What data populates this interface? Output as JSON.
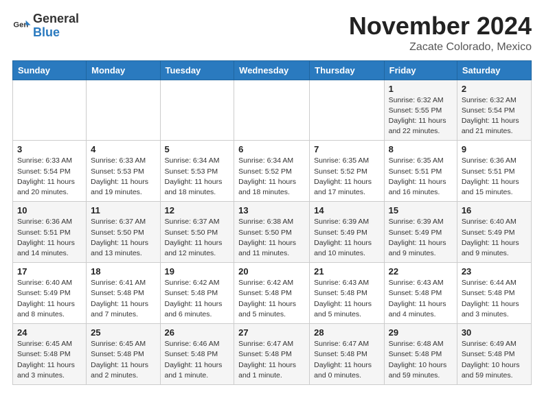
{
  "logo": {
    "general": "General",
    "blue": "Blue"
  },
  "title": "November 2024",
  "location": "Zacate Colorado, Mexico",
  "weekdays": [
    "Sunday",
    "Monday",
    "Tuesday",
    "Wednesday",
    "Thursday",
    "Friday",
    "Saturday"
  ],
  "weeks": [
    [
      {
        "day": "",
        "info": ""
      },
      {
        "day": "",
        "info": ""
      },
      {
        "day": "",
        "info": ""
      },
      {
        "day": "",
        "info": ""
      },
      {
        "day": "",
        "info": ""
      },
      {
        "day": "1",
        "info": "Sunrise: 6:32 AM\nSunset: 5:55 PM\nDaylight: 11 hours\nand 22 minutes."
      },
      {
        "day": "2",
        "info": "Sunrise: 6:32 AM\nSunset: 5:54 PM\nDaylight: 11 hours\nand 21 minutes."
      }
    ],
    [
      {
        "day": "3",
        "info": "Sunrise: 6:33 AM\nSunset: 5:54 PM\nDaylight: 11 hours\nand 20 minutes."
      },
      {
        "day": "4",
        "info": "Sunrise: 6:33 AM\nSunset: 5:53 PM\nDaylight: 11 hours\nand 19 minutes."
      },
      {
        "day": "5",
        "info": "Sunrise: 6:34 AM\nSunset: 5:53 PM\nDaylight: 11 hours\nand 18 minutes."
      },
      {
        "day": "6",
        "info": "Sunrise: 6:34 AM\nSunset: 5:52 PM\nDaylight: 11 hours\nand 18 minutes."
      },
      {
        "day": "7",
        "info": "Sunrise: 6:35 AM\nSunset: 5:52 PM\nDaylight: 11 hours\nand 17 minutes."
      },
      {
        "day": "8",
        "info": "Sunrise: 6:35 AM\nSunset: 5:51 PM\nDaylight: 11 hours\nand 16 minutes."
      },
      {
        "day": "9",
        "info": "Sunrise: 6:36 AM\nSunset: 5:51 PM\nDaylight: 11 hours\nand 15 minutes."
      }
    ],
    [
      {
        "day": "10",
        "info": "Sunrise: 6:36 AM\nSunset: 5:51 PM\nDaylight: 11 hours\nand 14 minutes."
      },
      {
        "day": "11",
        "info": "Sunrise: 6:37 AM\nSunset: 5:50 PM\nDaylight: 11 hours\nand 13 minutes."
      },
      {
        "day": "12",
        "info": "Sunrise: 6:37 AM\nSunset: 5:50 PM\nDaylight: 11 hours\nand 12 minutes."
      },
      {
        "day": "13",
        "info": "Sunrise: 6:38 AM\nSunset: 5:50 PM\nDaylight: 11 hours\nand 11 minutes."
      },
      {
        "day": "14",
        "info": "Sunrise: 6:39 AM\nSunset: 5:49 PM\nDaylight: 11 hours\nand 10 minutes."
      },
      {
        "day": "15",
        "info": "Sunrise: 6:39 AM\nSunset: 5:49 PM\nDaylight: 11 hours\nand 9 minutes."
      },
      {
        "day": "16",
        "info": "Sunrise: 6:40 AM\nSunset: 5:49 PM\nDaylight: 11 hours\nand 9 minutes."
      }
    ],
    [
      {
        "day": "17",
        "info": "Sunrise: 6:40 AM\nSunset: 5:49 PM\nDaylight: 11 hours\nand 8 minutes."
      },
      {
        "day": "18",
        "info": "Sunrise: 6:41 AM\nSunset: 5:48 PM\nDaylight: 11 hours\nand 7 minutes."
      },
      {
        "day": "19",
        "info": "Sunrise: 6:42 AM\nSunset: 5:48 PM\nDaylight: 11 hours\nand 6 minutes."
      },
      {
        "day": "20",
        "info": "Sunrise: 6:42 AM\nSunset: 5:48 PM\nDaylight: 11 hours\nand 5 minutes."
      },
      {
        "day": "21",
        "info": "Sunrise: 6:43 AM\nSunset: 5:48 PM\nDaylight: 11 hours\nand 5 minutes."
      },
      {
        "day": "22",
        "info": "Sunrise: 6:43 AM\nSunset: 5:48 PM\nDaylight: 11 hours\nand 4 minutes."
      },
      {
        "day": "23",
        "info": "Sunrise: 6:44 AM\nSunset: 5:48 PM\nDaylight: 11 hours\nand 3 minutes."
      }
    ],
    [
      {
        "day": "24",
        "info": "Sunrise: 6:45 AM\nSunset: 5:48 PM\nDaylight: 11 hours\nand 3 minutes."
      },
      {
        "day": "25",
        "info": "Sunrise: 6:45 AM\nSunset: 5:48 PM\nDaylight: 11 hours\nand 2 minutes."
      },
      {
        "day": "26",
        "info": "Sunrise: 6:46 AM\nSunset: 5:48 PM\nDaylight: 11 hours\nand 1 minute."
      },
      {
        "day": "27",
        "info": "Sunrise: 6:47 AM\nSunset: 5:48 PM\nDaylight: 11 hours\nand 1 minute."
      },
      {
        "day": "28",
        "info": "Sunrise: 6:47 AM\nSunset: 5:48 PM\nDaylight: 11 hours\nand 0 minutes."
      },
      {
        "day": "29",
        "info": "Sunrise: 6:48 AM\nSunset: 5:48 PM\nDaylight: 10 hours\nand 59 minutes."
      },
      {
        "day": "30",
        "info": "Sunrise: 6:49 AM\nSunset: 5:48 PM\nDaylight: 10 hours\nand 59 minutes."
      }
    ]
  ]
}
